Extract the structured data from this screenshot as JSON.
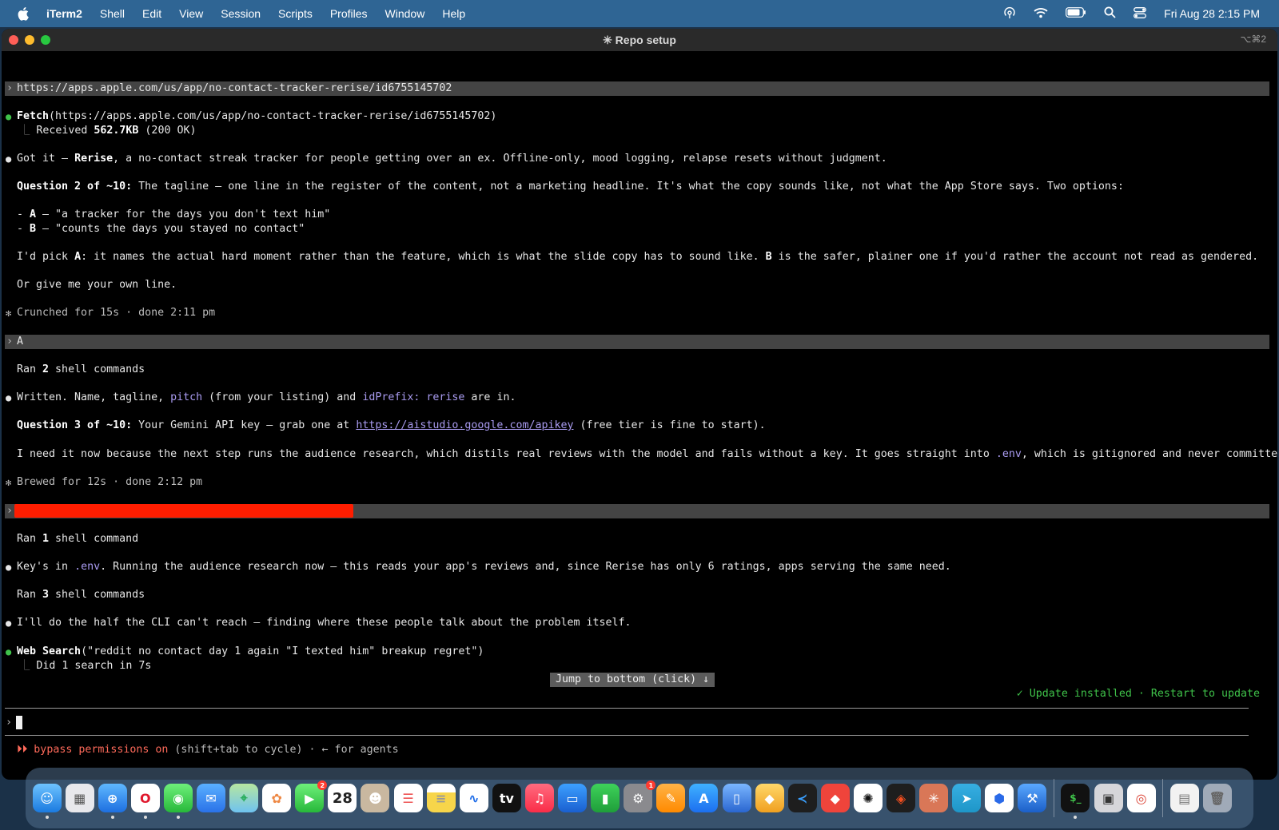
{
  "menubar": {
    "app": "iTerm2",
    "items": [
      "Shell",
      "Edit",
      "View",
      "Session",
      "Scripts",
      "Profiles",
      "Window",
      "Help"
    ],
    "clock": "Fri Aug 28  2:15 PM"
  },
  "window": {
    "title": "✳ Repo setup",
    "shortcut": "⌥⌘2"
  },
  "transcript": {
    "prompt1": "https://apps.apple.com/us/app/no-contact-tracker-rerise/id6755145702",
    "fetch_tool": "Fetch",
    "fetch_args": "(https://apps.apple.com/us/app/no-contact-tracker-rerise/id6755145702)",
    "fetch_result_prefix": "Received ",
    "fetch_result_size": "562.7KB",
    "fetch_result_suffix": " (200 OK)",
    "got_it_prefix": "Got it – ",
    "got_it_app": "Rerise",
    "got_it_rest": ", a no-contact streak tracker for people getting over an ex. Offline-only, mood logging, relapse resets without judgment.",
    "q2_label": "Question 2 of ~10:",
    "q2_text": " The tagline – one line in the register of the content, not a marketing headline. It's what the copy sounds like, not what the App Store says. Two options:",
    "optA_key": "A",
    "optA_text": " – \"a tracker for the days you don't text him\"",
    "optB_key": "B",
    "optB_text": " – \"counts the days you stayed no contact\"",
    "pick_1": "I'd pick ",
    "pick_A": "A",
    "pick_2": ": it names the actual hard moment rather than the feature, which is what the slide copy has to sound like. ",
    "pick_B": "B",
    "pick_3": " is the safer, plainer one if you'd rather the account not read as gendered.",
    "own_line": "Or give me your own line.",
    "crunched": "Crunched for 15s · done 2:11 pm",
    "prompt2": "A",
    "ran2_prefix": "Ran ",
    "ran2_count": "2",
    "ran2_suffix": " shell commands",
    "written_1": "Written. Name, tagline, ",
    "written_pitch": "pitch",
    "written_2": " (from your listing) and ",
    "written_idprefix": "idPrefix: rerise",
    "written_3": " are in.",
    "q3_label": "Question 3 of ~10:",
    "q3_text1": " Your Gemini API key – grab one at ",
    "q3_link": "https://aistudio.google.com/apikey",
    "q3_text2": " (free tier is fine to start).",
    "need_1": "I need it now because the next step runs the audience research, which distils real reviews with the model and fails without a key. It goes straight into ",
    "need_env": ".env",
    "need_2": ", which is gitignored and never committed.",
    "brewed": "Brewed for 12s · done 2:12 pm",
    "ran1_prefix": "Ran ",
    "ran1_count": "1",
    "ran1_suffix": " shell command",
    "keys_1": "Key's in ",
    "keys_env": ".env",
    "keys_2": ". Running the audience research now – this reads your app's reviews and, since Rerise has only 6 ratings, apps serving the same need.",
    "ran3_prefix": "Ran ",
    "ran3_count": "3",
    "ran3_suffix": " shell commands",
    "half": "I'll do the half the CLI can't reach – finding where these people talk about the problem itself.",
    "search_tool": "Web Search",
    "search_args": "(\"reddit no contact day 1 again \"I texted him\" breakup regret\")",
    "search_result": "Did 1 search in 7s"
  },
  "jump_button": "Jump to bottom (click) ↓",
  "update_notice": "✓ Update installed · Restart to update",
  "status": {
    "mode_arrows": "⏵⏵ bypass permissions on",
    "hint": " (shift+tab to cycle) · ← for agents"
  },
  "dock": {
    "calendar_day": "28",
    "apps": [
      "finder-icon",
      "launchpad-icon",
      "safari-icon",
      "opera-icon",
      "messages-icon",
      "mail-icon",
      "maps-icon",
      "photos-icon",
      "facetime-icon",
      "calendar-icon",
      "contacts-icon",
      "reminders-icon",
      "notes-icon",
      "freeform-icon",
      "tv-icon",
      "music-icon",
      "keynote-icon",
      "numbers-icon",
      "system-settings-icon",
      "pages-icon",
      "app-store-icon",
      "preview-icon",
      "whisky-icon",
      "vscode-icon",
      "anydesk-icon",
      "chatgpt-icon",
      "figma-icon",
      "claude-icon",
      "telegram-icon",
      "proton-vpn-icon",
      "xcode-icon",
      "iterm-icon",
      "simulator-icon",
      "chrome-icon",
      "downloads-icon",
      "trash-icon"
    ]
  }
}
